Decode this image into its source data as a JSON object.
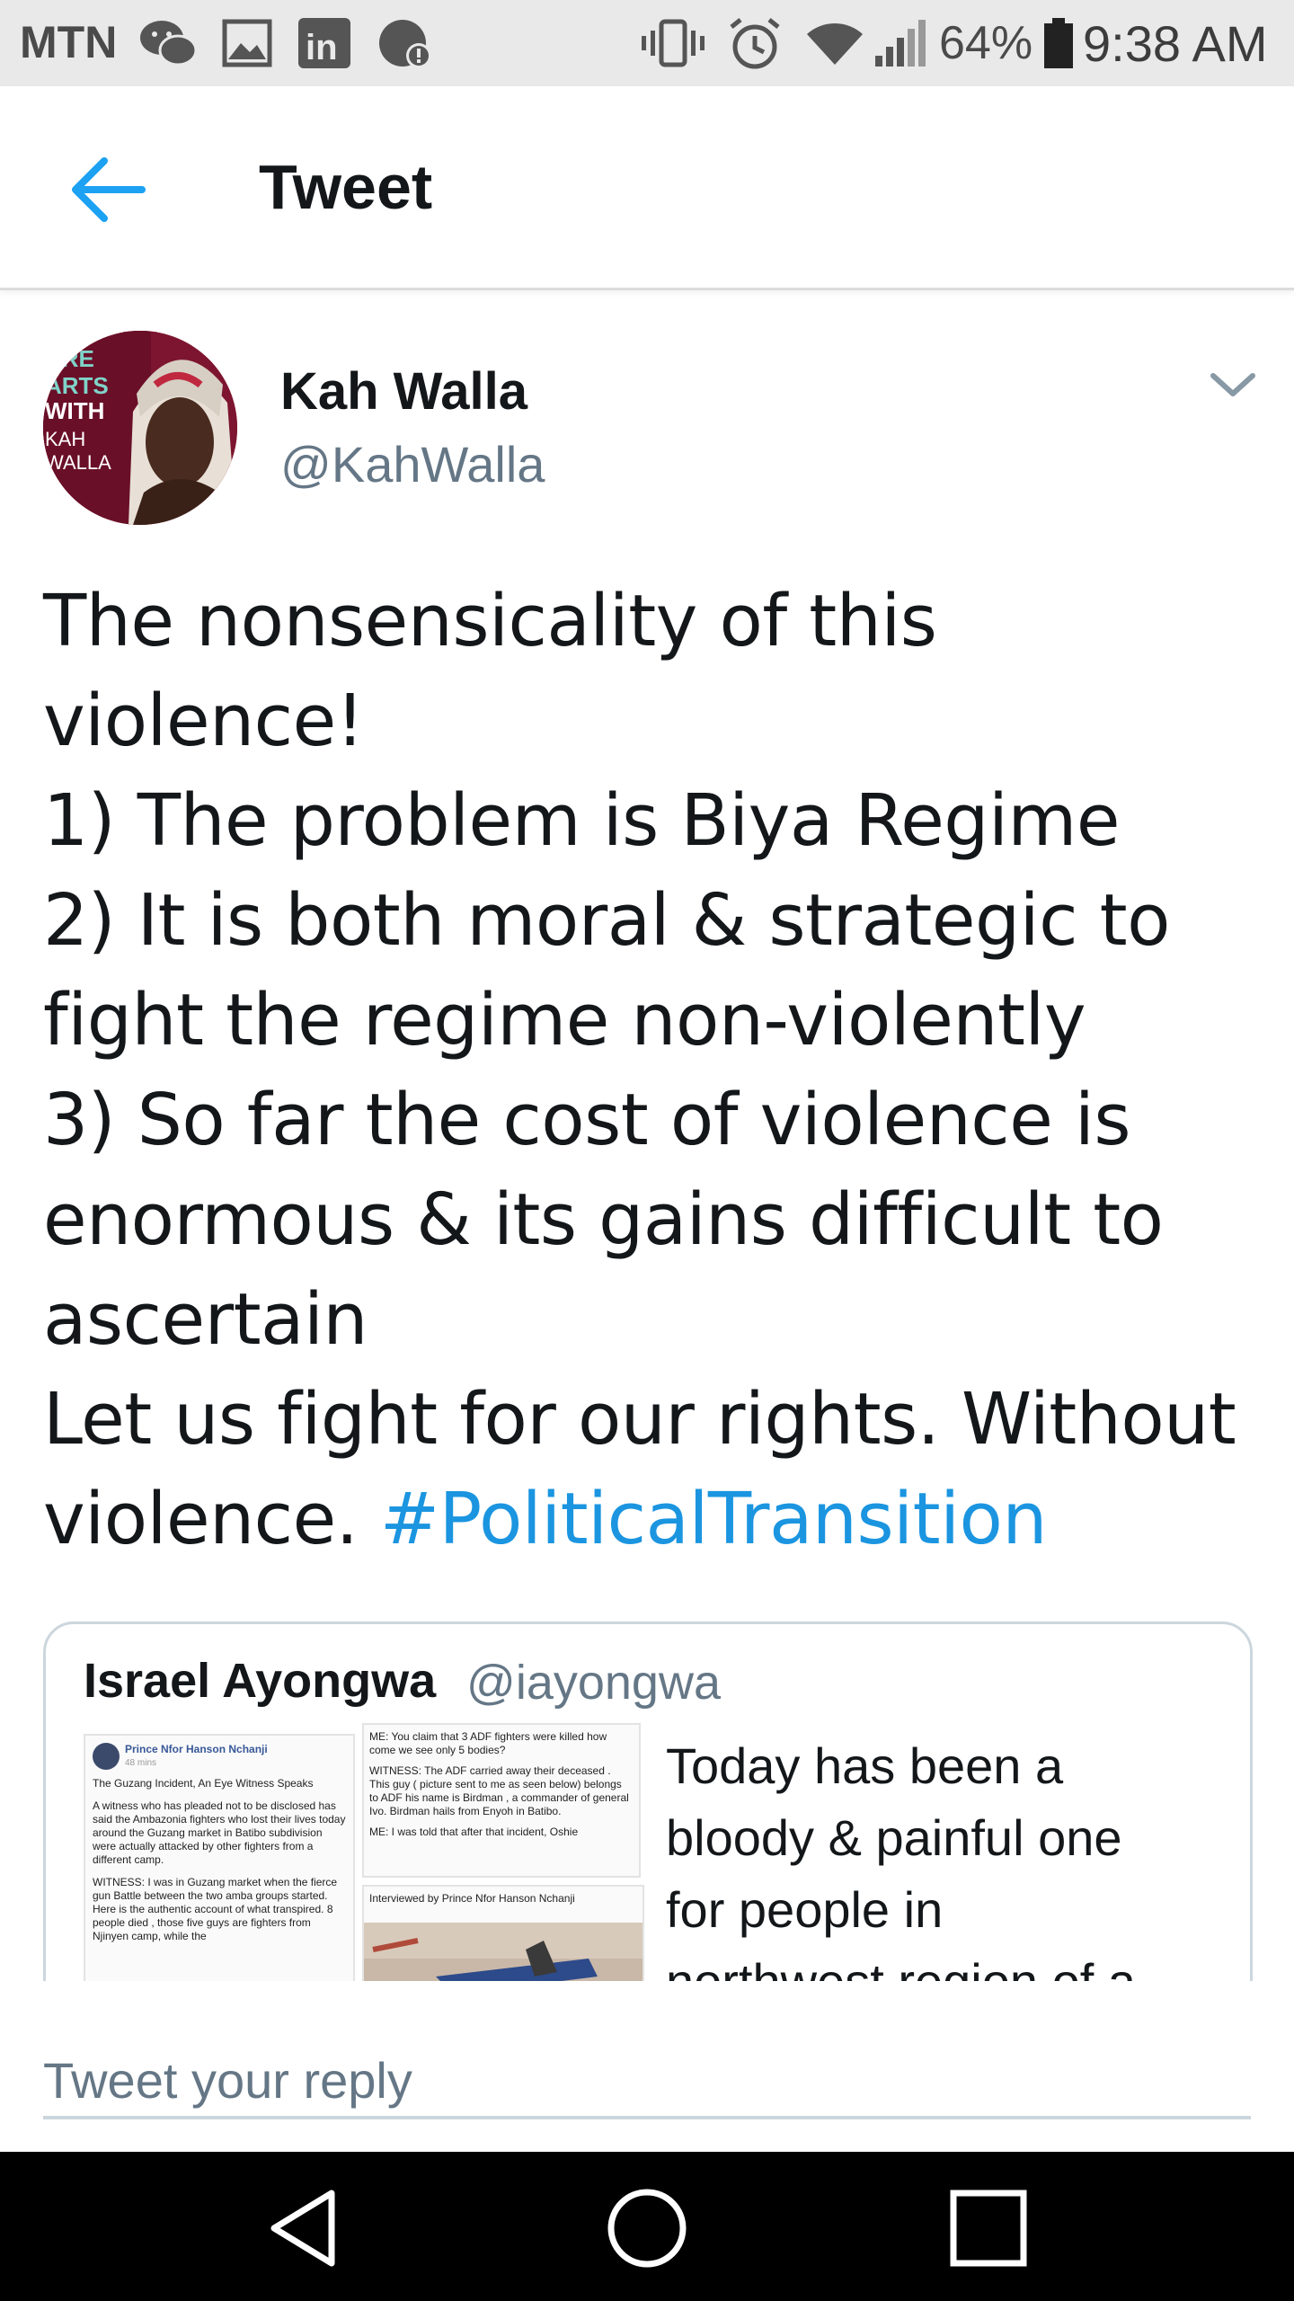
{
  "status_bar": {
    "carrier": "MTN",
    "battery_percent": "64%",
    "time": "9:38 AM",
    "icons": [
      "wechat-icon",
      "gallery-icon",
      "linkedin-icon",
      "messenger-icon",
      "vibrate-icon",
      "alarm-icon",
      "wifi-icon",
      "signal-icon",
      "battery-icon"
    ]
  },
  "header": {
    "title": "Tweet",
    "back_icon": "arrow-left-icon",
    "accent_color": "#1da1f2"
  },
  "tweet": {
    "author_name": "Kah Walla",
    "author_handle": "@KahWalla",
    "avatar_text": [
      "URE",
      "ARTS",
      "WITH",
      "KAH",
      "WALLA"
    ],
    "lines": [
      "The nonsensicality of this",
      "violence!",
      "1) The problem is Biya Regime",
      "2) It is both moral & strategic to",
      "fight the regime non-violently",
      "3) So far the cost of violence is",
      "enormous & its gains difficult to",
      "ascertain",
      "Let us fight for our rights. Without",
      "violence. "
    ],
    "hashtag": "#PoliticalTransition",
    "hashtag_color": "#1b95e0"
  },
  "quoted_tweet": {
    "author_name": "Israel Ayongwa",
    "author_handle": "@iayongwa",
    "text_lines": [
      "Today has been a",
      "bloody & painful one",
      "for people in",
      "northwest region of a"
    ],
    "image_left": {
      "poster": "Prince Nfor Hanson Nchanji",
      "time": "48 mins",
      "title": "The Guzang Incident, An Eye Witness Speaks",
      "para1": "A witness who has pleaded not to be disclosed has said the Ambazonia fighters who lost their lives today around the Guzang market in Batibo subdivision were actually attacked by other fighters from a different camp.",
      "para2": "WITNESS: I was in Guzang market when the fierce gun Battle between the two amba groups started. Here is the authentic account of what transpired. 8 people died , those five guys are fighters from Njinyen camp, while the"
    },
    "image_right_top": {
      "q": "ME: You claim that 3 ADF fighters were killed how come we see only 5 bodies?",
      "a": "WITNESS: The ADF carried away their deceased . This guy ( picture sent to me as seen below) belongs to ADF his name is Birdman , a commander of general Ivo. Birdman hails from Enyoh in Batibo.",
      "cut": "ME: I was told that after that incident, Oshie"
    },
    "image_right_bottom": {
      "caption": "Interviewed by Prince Nfor Hanson Nchanji"
    }
  },
  "reply": {
    "placeholder": "Tweet your reply"
  },
  "nav_bar": {
    "icons": [
      "back-triangle-icon",
      "home-circle-icon",
      "recents-square-icon"
    ]
  }
}
